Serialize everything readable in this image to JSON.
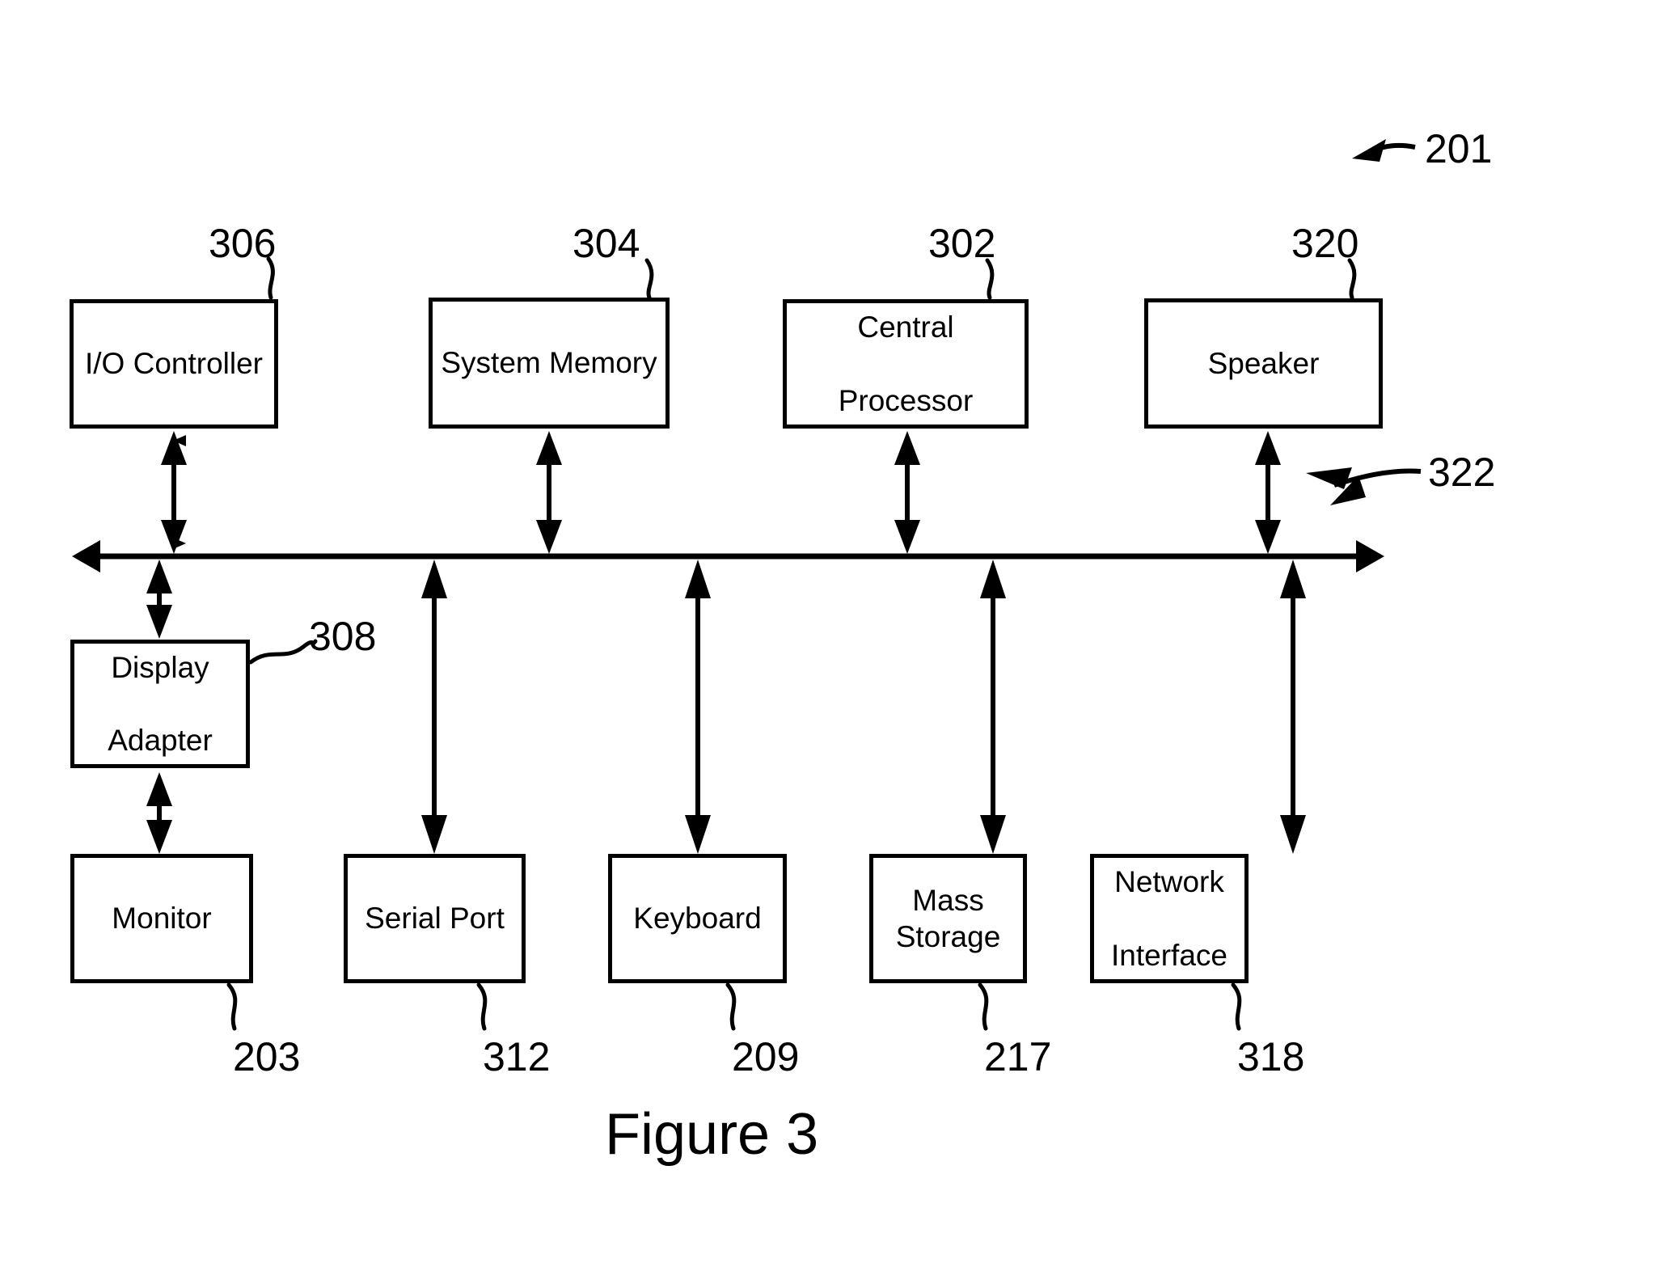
{
  "figure": {
    "caption": "Figure 3",
    "system_ref": "201",
    "bus_ref": "322"
  },
  "top_row": [
    {
      "label": "I/O Controller",
      "ref": "306",
      "lines": [
        "I/O Controller"
      ]
    },
    {
      "label": "System Memory",
      "ref": "304",
      "lines": [
        "System Memory"
      ]
    },
    {
      "label": "Central Processor",
      "ref": "302",
      "lines": [
        "Central",
        "Processor"
      ]
    },
    {
      "label": "Speaker",
      "ref": "320",
      "lines": [
        "Speaker"
      ]
    }
  ],
  "middle_row": [
    {
      "label": "Display Adapter",
      "ref": "308",
      "lines": [
        "Display",
        "Adapter"
      ]
    }
  ],
  "bottom_row": [
    {
      "label": "Monitor",
      "ref": "203",
      "lines": [
        "Monitor"
      ]
    },
    {
      "label": "Serial Port",
      "ref": "312",
      "lines": [
        "Serial Port"
      ]
    },
    {
      "label": "Keyboard",
      "ref": "209",
      "lines": [
        "Keyboard"
      ]
    },
    {
      "label": "Mass Storage",
      "ref": "217",
      "lines": [
        "Mass Storage"
      ]
    },
    {
      "label": "Network Interface",
      "ref": "318",
      "lines": [
        "Network",
        "Interface"
      ]
    }
  ],
  "colors": {
    "stroke": "#000000",
    "background": "#ffffff"
  }
}
